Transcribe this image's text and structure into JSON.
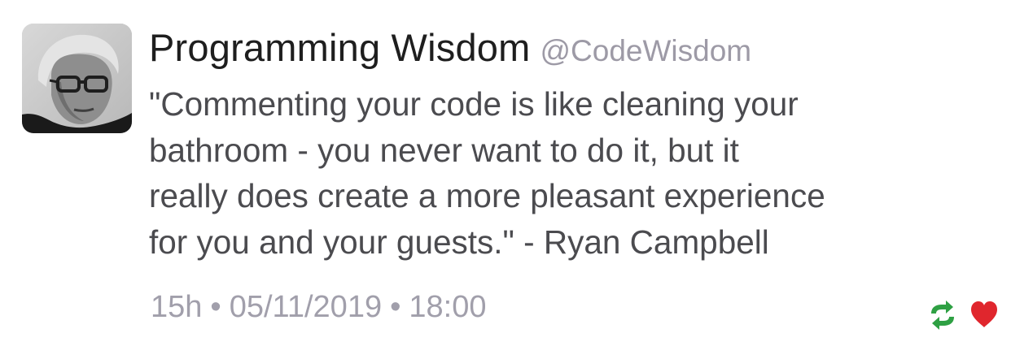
{
  "tweet": {
    "display_name": "Programming Wisdom",
    "handle": "@CodeWisdom",
    "text": "\"Commenting your code is like cleaning your\nbathroom - you never want to do it, but it\nreally does create a more pleasant experience\nfor you and your guests.\" - Ryan Campbell",
    "relative_time": "15h",
    "date": "05/11/2019",
    "time": "18:00",
    "separator": "•"
  },
  "icons": {
    "avatar": "avatar-photo",
    "retweet": "retweet-icon",
    "like": "heart-icon"
  },
  "colors": {
    "retweet": "#2ea043",
    "like": "#e0262d",
    "meta_text": "#a19fab",
    "handle_text": "#9d9aa6"
  }
}
